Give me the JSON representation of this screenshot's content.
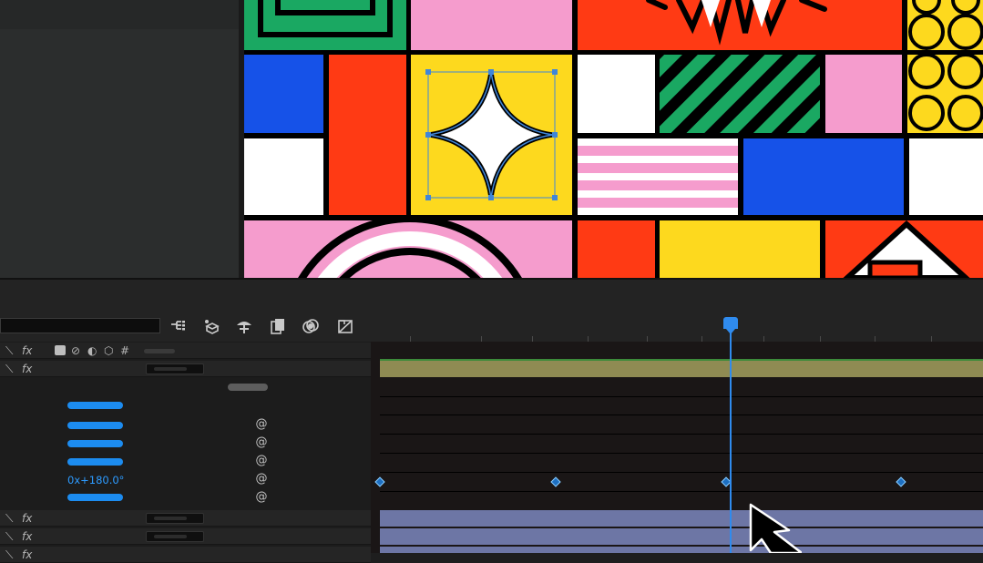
{
  "viewer": {
    "colors": {
      "green": "#1aa862",
      "pink": "#f59ccd",
      "red": "#ff3a14",
      "blue": "#1652e8",
      "yellow": "#fdd91e",
      "white": "#ffffff",
      "black": "#000000",
      "selection": "#3f86d9"
    }
  },
  "toolbar": {
    "icons": [
      "composition-flowchart-icon",
      "shy-layers-icon",
      "frame-blending-icon",
      "motion-blur-icon",
      "graph-editor-icon",
      "draft-3d-icon"
    ]
  },
  "layer_switches": {
    "fx_label": "fx"
  },
  "property": {
    "rotation_value": "0x+180.0°"
  },
  "timeline": {
    "accent": "#2f8bee",
    "work_area_color": "#6b6b6b",
    "layer_bar_gold": "#8f8b53",
    "layer_bar_lavender": "#6d76a5",
    "keyframe_times_frac": [
      0.0,
      0.33,
      0.65,
      0.98
    ],
    "playhead_frac": 0.65
  }
}
